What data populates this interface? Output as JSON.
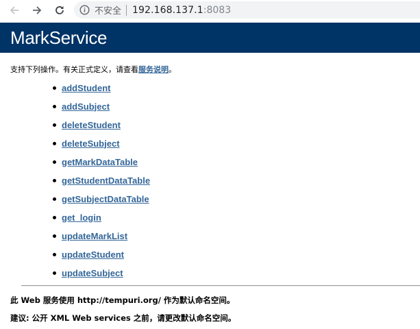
{
  "browser": {
    "security_label": "不安全",
    "url_host": "192.168.137.1",
    "url_port": ":8083",
    "icons": [
      "back-arrow-icon",
      "forward-arrow-icon",
      "reload-icon",
      "info-icon"
    ]
  },
  "header": {
    "title": "MarkService"
  },
  "intro": {
    "text": "支持下列操作。有关正式定义，请查看",
    "link_label": "服务说明",
    "end": "。"
  },
  "operations": [
    {
      "label": "addStudent"
    },
    {
      "label": "addSubject"
    },
    {
      "label": "deleteStudent"
    },
    {
      "label": "deleteSubject"
    },
    {
      "label": "getMarkDataTable"
    },
    {
      "label": "getStudentDataTable"
    },
    {
      "label": "getSubjectDataTable"
    },
    {
      "label": "get_login"
    },
    {
      "label": "updateMarkList"
    },
    {
      "label": "updateStudent"
    },
    {
      "label": "updateSubject"
    }
  ],
  "footer": {
    "line1": "此 Web 服务使用 http://tempuri.org/ 作为默认命名空间。",
    "line2": "建议: 公开 XML Web services 之前，请更改默认命名空间。"
  },
  "colors": {
    "header_bg": "#003366",
    "link": "#336699"
  }
}
